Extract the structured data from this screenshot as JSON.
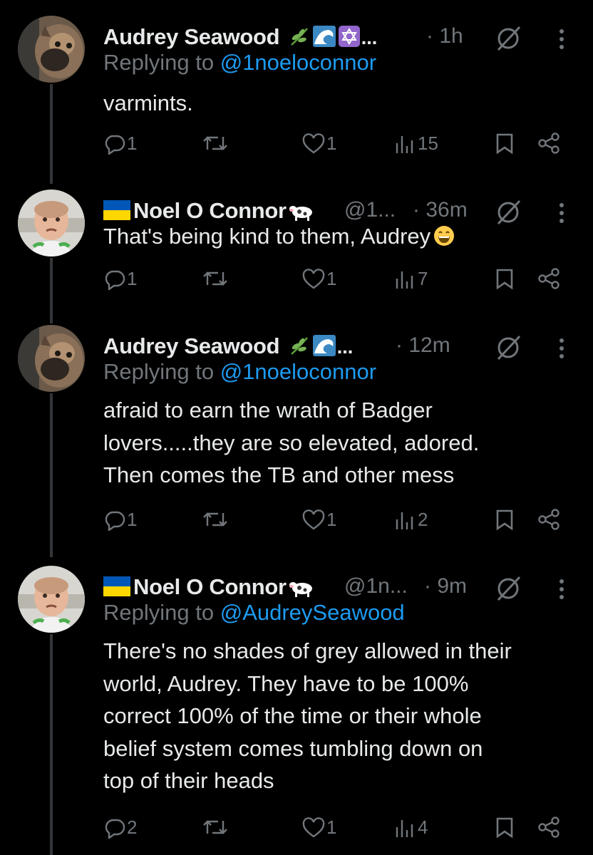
{
  "tweets": [
    {
      "name": "Audrey Seawood",
      "handle": "",
      "time": "· 1h",
      "replying_label": "Replying to ",
      "replying_handle": "@1noeloconnor",
      "text": "varmints.",
      "stats": {
        "replies": "1",
        "reposts": "",
        "likes": "1",
        "views": "15"
      }
    },
    {
      "name": "Noel O Connor",
      "handle": "@1...",
      "time": "· 36m",
      "replying_label": "",
      "replying_handle": "",
      "text": "That's being kind to them, Audrey",
      "stats": {
        "replies": "1",
        "reposts": "",
        "likes": "1",
        "views": "7"
      }
    },
    {
      "name": "Audrey Seawood",
      "handle": "",
      "time": "· 12m",
      "replying_label": "Replying to ",
      "replying_handle": "@1noeloconnor",
      "text_lines": [
        "afraid to earn the wrath of Badger",
        "lovers.....they are so elevated, adored.",
        "Then comes the TB and other mess"
      ],
      "stats": {
        "replies": "1",
        "reposts": "",
        "likes": "1",
        "views": "2"
      }
    },
    {
      "name": "Noel O Connor",
      "handle": "@1n...",
      "time": "· 9m",
      "replying_label": "Replying to ",
      "replying_handle": "@AudreySeawood",
      "text_lines": [
        "There's no shades of grey allowed in their",
        "world, Audrey. They have to be 100%",
        "correct 100% of the time or their whole",
        "belief system comes tumbling down on",
        "top of their heads"
      ],
      "stats": {
        "replies": "2",
        "reposts": "",
        "likes": "1",
        "views": "4"
      }
    }
  ],
  "colors": {
    "background": "#000000",
    "text": "#e7e9ea",
    "muted": "#71767b",
    "link": "#1d9bf0",
    "thread_line": "#333639"
  },
  "icons": {
    "reply": "reply-bubble-icon",
    "repost": "repost-arrows-icon",
    "like": "heart-icon",
    "views": "views-bars-icon",
    "bookmark": "bookmark-icon",
    "share": "share-icon",
    "grok": "grok-slash-icon",
    "more": "more-vertical-icon"
  }
}
